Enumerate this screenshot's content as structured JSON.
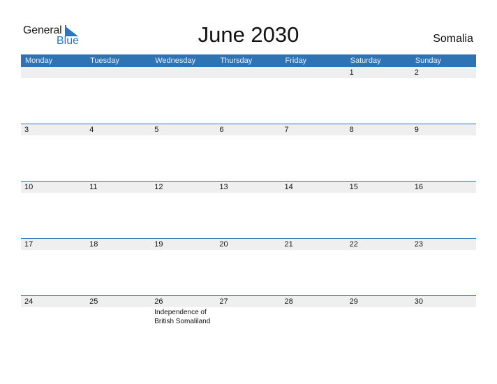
{
  "logo": {
    "general": "General",
    "blue": "Blue",
    "icon": "triangle-flag-icon"
  },
  "title": "June 2030",
  "country": "Somalia",
  "weekdays": [
    "Monday",
    "Tuesday",
    "Wednesday",
    "Thursday",
    "Friday",
    "Saturday",
    "Sunday"
  ],
  "weeks": [
    {
      "days": [
        "",
        "",
        "",
        "",
        "",
        "1",
        "2"
      ],
      "events": [
        "",
        "",
        "",
        "",
        "",
        "",
        ""
      ]
    },
    {
      "days": [
        "3",
        "4",
        "5",
        "6",
        "7",
        "8",
        "9"
      ],
      "events": [
        "",
        "",
        "",
        "",
        "",
        "",
        ""
      ]
    },
    {
      "days": [
        "10",
        "11",
        "12",
        "13",
        "14",
        "15",
        "16"
      ],
      "events": [
        "",
        "",
        "",
        "",
        "",
        "",
        ""
      ]
    },
    {
      "days": [
        "17",
        "18",
        "19",
        "20",
        "21",
        "22",
        "23"
      ],
      "events": [
        "",
        "",
        "",
        "",
        "",
        "",
        ""
      ]
    },
    {
      "days": [
        "24",
        "25",
        "26",
        "27",
        "28",
        "29",
        "30"
      ],
      "events": [
        "",
        "",
        "Independence of\nBritish Somaliland",
        "",
        "",
        "",
        ""
      ]
    }
  ],
  "colors": {
    "header_bg": "#2e73b4",
    "date_strip_bg": "#efefef",
    "brand_blue": "#2a75c0"
  }
}
